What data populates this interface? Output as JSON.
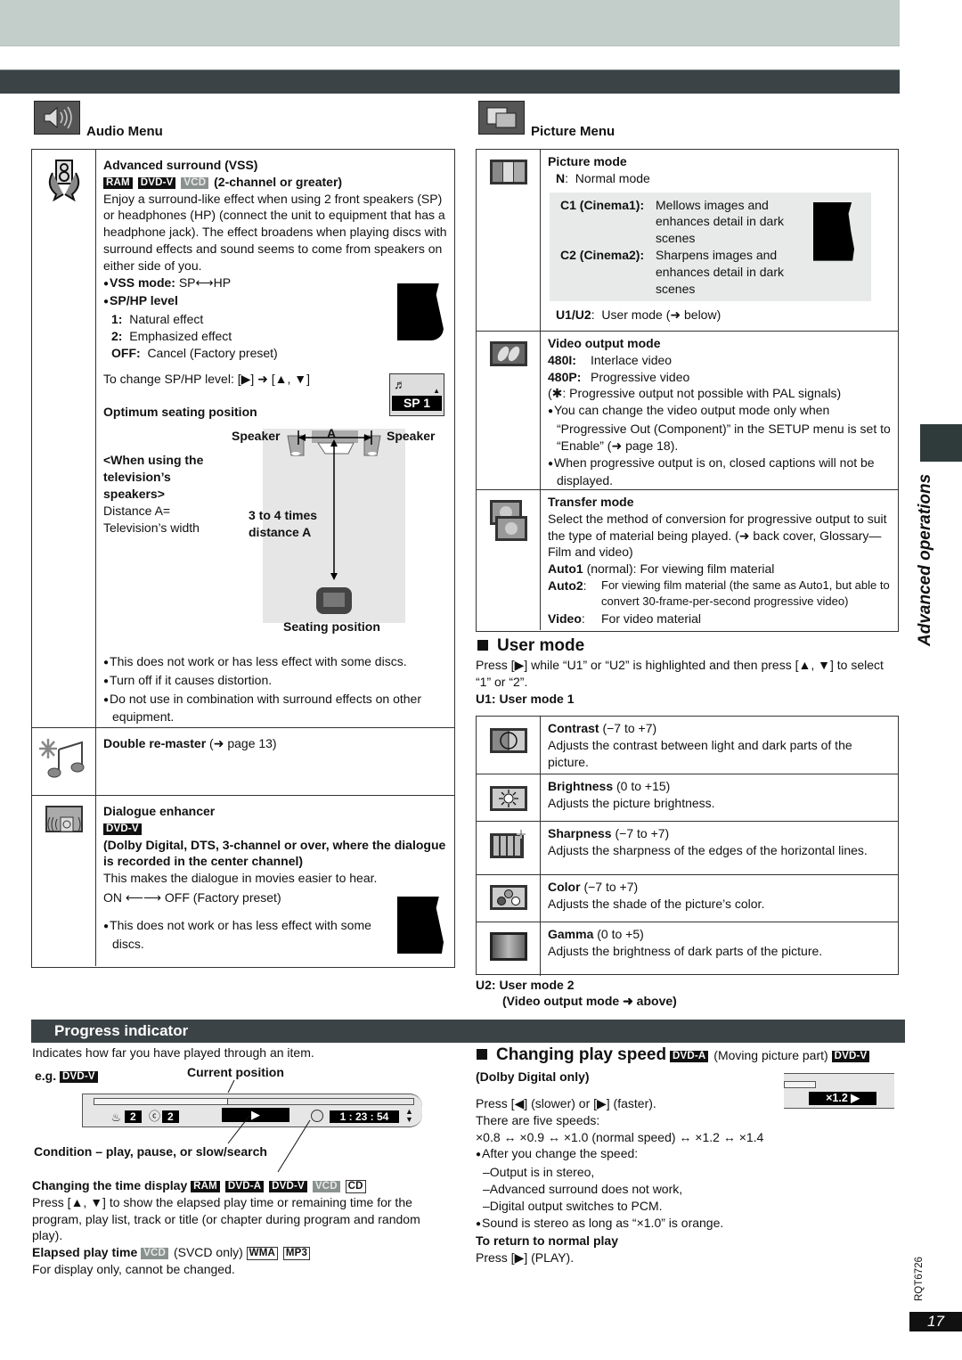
{
  "side_tab": {
    "label": "Advanced operations"
  },
  "doc_code": "RQT6726",
  "page_number": "17",
  "audio_menu": {
    "title": "Audio Menu",
    "vss": {
      "title": "Advanced surround (VSS)",
      "tags": [
        "RAM",
        "DVD-V",
        "VCD"
      ],
      "condition": "(2-channel or greater)",
      "description": "Enjoy a surround-like effect when using 2 front speakers (SP) or headphones (HP) (connect the unit to equipment that has a headphone jack). The effect broadens when playing discs with surround effects and sound seems to come from speakers on either side of you.",
      "mode_label": "VSS mode:",
      "mode_value": "SP⟷HP",
      "level_label": "SP/HP level",
      "levels": [
        {
          "key": "1:",
          "value": "Natural effect"
        },
        {
          "key": "2:",
          "value": "Emphasized effect"
        },
        {
          "key": "OFF:",
          "value": "Cancel (Factory preset)"
        }
      ],
      "change_level": "To change SP/HP level:  [▶] ➜ [▲, ▼]",
      "osd_value": "SP  1",
      "seating_title": "Optimum seating position",
      "tv_note_bold": "<When using the television’s speakers>",
      "tv_note_1": "Distance A=",
      "tv_note_2": "Television’s width",
      "diagram": {
        "speaker_left": "Speaker",
        "speaker_right": "Speaker",
        "distance_label": "A",
        "distance_text": "3 to 4 times distance A",
        "seat_label": "Seating position"
      },
      "notes": [
        "This does not work or has less effect with some discs.",
        "Turn off if it causes distortion.",
        "Do not use in combination with surround effects on other equipment."
      ]
    },
    "remaster": {
      "title": "Double re-master",
      "ref": "(➜ page 13)"
    },
    "dialogue": {
      "title": "Dialogue enhancer",
      "tag": "DVD-V",
      "condition": "(Dolby Digital, DTS, 3-channel or over, where the dialogue is recorded in the center channel)",
      "description": "This makes the dialogue in movies easier to hear.",
      "toggle": "ON ⟵⟶ OFF (Factory preset)",
      "note": "This does not work or has less effect with some discs."
    }
  },
  "picture_menu": {
    "title": "Picture Menu",
    "picture_mode": {
      "title": "Picture mode",
      "normal": {
        "key": "N",
        "value": "Normal mode"
      },
      "cinema": [
        {
          "key": "C1 (Cinema1):",
          "value": "Mellows images and enhances detail in dark scenes"
        },
        {
          "key": "C2 (Cinema2):",
          "value": "Sharpens images and enhances detail in dark scenes"
        }
      ],
      "user": {
        "key": "U1/U2",
        "value": "User mode (➜ below)"
      }
    },
    "video_output": {
      "title": "Video output mode",
      "options": [
        {
          "key": "480I:",
          "value": "Interlace video"
        },
        {
          "key": "480P:",
          "value": "Progressive video"
        }
      ],
      "pal_note": "(✱:  Progressive output not possible with PAL signals)",
      "notes": [
        "You can change the video output mode only when “Progressive Out (Component)” in the SETUP menu is set to “Enable” (➜ page 18).",
        "When progressive output is on, closed captions will not be displayed."
      ]
    },
    "transfer": {
      "title": "Transfer mode",
      "description": "Select the method of conversion for progressive output to suit the type of material being played. (➜ back cover, Glossary—Film and video)",
      "auto1_key": "Auto1",
      "auto1_value": "(normal): For viewing film material",
      "auto2_key": "Auto2",
      "auto2_value": "For viewing film material (the same as Auto1, but able to convert 30-frame-per-second progressive video)",
      "video_key": "Video",
      "video_value": "For video material"
    }
  },
  "user_mode": {
    "title": "User mode",
    "intro": "Press [▶] while “U1” or “U2” is highlighted and then press [▲, ▼] to select “1” or “2”.",
    "u1_label": "U1:  User mode 1",
    "settings": [
      {
        "name": "Contrast",
        "range": "(−7 to +7)",
        "desc": "Adjusts the contrast between light and dark parts of the picture."
      },
      {
        "name": "Brightness",
        "range": "(0 to +15)",
        "desc": "Adjusts the picture brightness."
      },
      {
        "name": "Sharpness",
        "range": "(−7 to +7)",
        "desc": "Adjusts the sharpness of the edges of the horizontal lines."
      },
      {
        "name": "Color",
        "range": "(−7 to +7)",
        "desc": "Adjusts the shade of the picture’s color."
      },
      {
        "name": "Gamma",
        "range": "(0 to +5)",
        "desc": "Adjusts the brightness of dark parts of the picture."
      }
    ],
    "u2_label": "U2:  User mode 2",
    "u2_note": "(Video output mode ➜   above)"
  },
  "progress": {
    "title": "Progress indicator",
    "intro": "Indicates how far you have played through an item.",
    "eg": "e.g.",
    "eg_tag": "DVD-V",
    "current_position": "Current position",
    "progress_fraction": 0.42,
    "title_num": "2",
    "chapter_num": "2",
    "play_symbol": "▶",
    "time": "1 : 23 : 54",
    "condition": "Condition – play, pause, or slow/search",
    "change_time_title": "Changing the time display",
    "change_time_tags": [
      "RAM",
      "DVD-A",
      "DVD-V",
      "VCD",
      "CD"
    ],
    "change_time_desc": "Press [▲, ▼] to show the elapsed play time or remaining time for the program, play list, track or title (or chapter during program and random play).",
    "elapsed_title": "Elapsed play time",
    "elapsed_tag": "VCD",
    "elapsed_note": "(SVCD only)",
    "elapsed_tags2": [
      "WMA",
      "MP3"
    ],
    "elapsed_desc": "For display only, cannot be changed."
  },
  "play_speed": {
    "title": "Changing play speed",
    "tag1": "DVD-A",
    "middle": "(Moving picture part)",
    "tag2": "DVD-V",
    "sub": "(Dolby Digital only)",
    "press": "Press [◀] (slower) or [▶] (faster).",
    "five": "There are five speeds:",
    "speeds": "×0.8   ↔ ×0.9 ↔ ×1.0 (normal speed) ↔ ×1.2 ↔ ×1.4",
    "osd_value": "×1.2 ▶",
    "after": "After you change the speed:",
    "effects": [
      "–Output is in stereo,",
      "–Advanced surround does not work,",
      "–Digital output switches to PCM."
    ],
    "stereo_note": "Sound is stereo as long as “×1.0” is orange.",
    "return_title": "To return to normal play",
    "return_desc": "Press [▶] (PLAY)."
  }
}
